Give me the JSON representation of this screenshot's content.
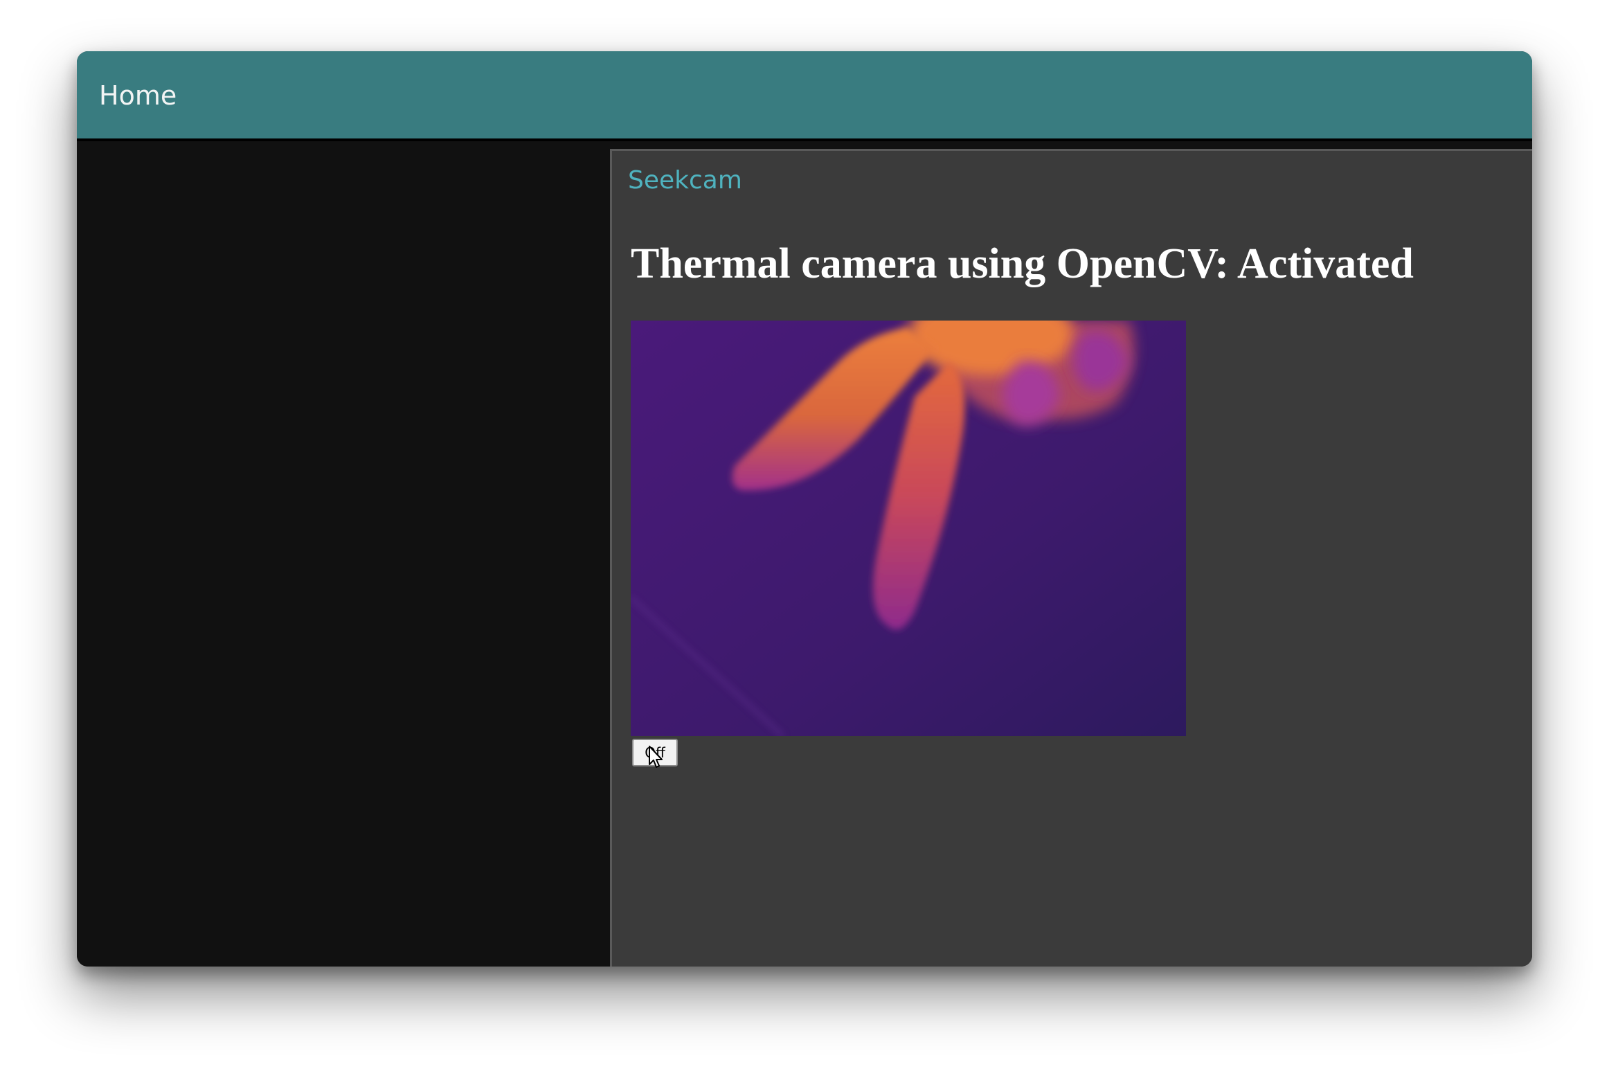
{
  "header": {
    "home_label": "Home"
  },
  "nav": {
    "seekcam_label": "Seekcam"
  },
  "main": {
    "heading": "Thermal camera using OpenCV: Activated",
    "camera_alt": "thermal camera feed",
    "off_button_label": "Off"
  },
  "colors": {
    "header_bg": "#397c80",
    "link": "#4fb3bf",
    "content_bg": "#3b3b3b",
    "side_bg": "#111111",
    "thermal_cold": "#3e1a6e",
    "thermal_hot": "#e9803f"
  }
}
